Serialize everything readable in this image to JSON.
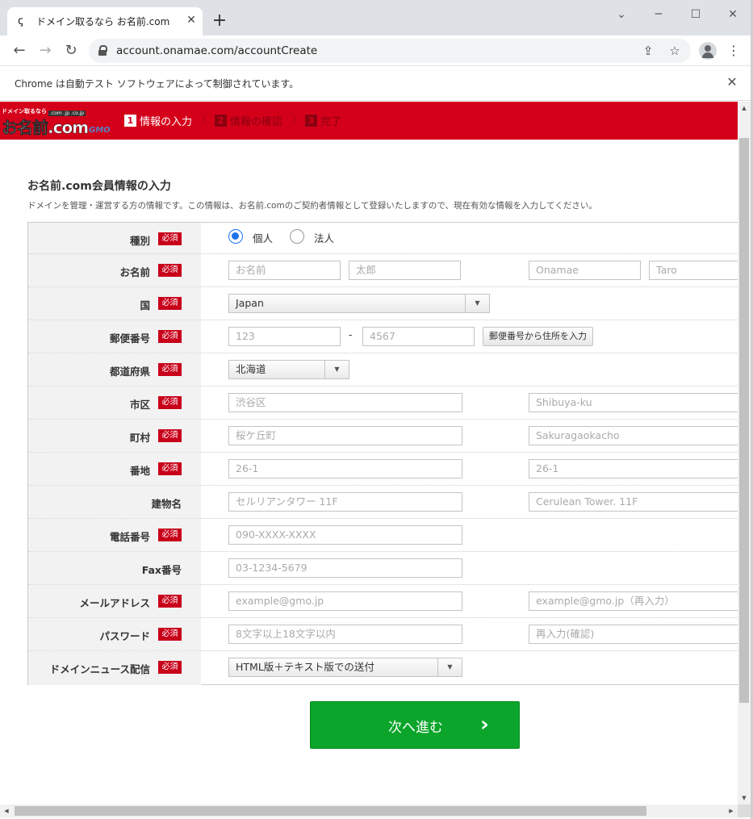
{
  "browser": {
    "tab_title": "ドメイン取るなら お名前.com",
    "tab_close": "✕",
    "new_tab": "+",
    "url": "account.onamae.com/accountCreate",
    "infobar_text": "Chrome は自動テスト ソフトウェアによって制御されています。",
    "infobar_close": "✕"
  },
  "header": {
    "logo_top": "ドメイン取るなら",
    "logo_main": "お名前.com",
    "logo_tlds": ".com .jp .co.jp",
    "logo_gmo": "GMO",
    "steps": [
      {
        "num": "1",
        "label": "情報の入力"
      },
      {
        "num": "2",
        "label": "情報の確認"
      },
      {
        "num": "3",
        "label": "完了"
      }
    ]
  },
  "form": {
    "title": "お名前.com会員情報の入力",
    "description": "ドメインを管理・運営する方の情報です。この情報は、お名前.comのご契約者情報として登録いたしますので、現在有効な情報を入力してください。",
    "required_badge": "必須",
    "rows": {
      "type": {
        "label": "種別",
        "options": [
          "個人",
          "法人"
        ],
        "selected": "個人"
      },
      "name": {
        "label": "お名前",
        "placeholders": [
          "お名前",
          "太郎",
          "Onamae",
          "Taro"
        ]
      },
      "country": {
        "label": "国",
        "value": "Japan"
      },
      "postal": {
        "label": "郵便番号",
        "placeholders": [
          "123",
          "4567"
        ],
        "separator": "-",
        "button": "郵便番号から住所を入力"
      },
      "prefecture": {
        "label": "都道府県",
        "value": "北海道"
      },
      "city": {
        "label": "市区",
        "placeholders": [
          "渋谷区",
          "Shibuya-ku"
        ]
      },
      "town": {
        "label": "町村",
        "placeholders": [
          "桜ケ丘町",
          "Sakuragaokacho"
        ]
      },
      "street": {
        "label": "番地",
        "placeholders": [
          "26-1",
          "26-1"
        ]
      },
      "building": {
        "label": "建物名",
        "placeholders": [
          "セルリアンタワー 11F",
          "Cerulean Tower. 11F"
        ]
      },
      "phone": {
        "label": "電話番号",
        "placeholder": "090-XXXX-XXXX"
      },
      "fax": {
        "label": "Fax番号",
        "placeholder": "03-1234-5679"
      },
      "email": {
        "label": "メールアドレス",
        "placeholders": [
          "example@gmo.jp",
          "example@gmo.jp（再入力）"
        ]
      },
      "password": {
        "label": "パスワード",
        "placeholders": [
          "8文字以上18文字以内",
          "再入力(確認)"
        ]
      },
      "news": {
        "label": "ドメインニュース配信",
        "value": "HTML版＋テキスト版での送付"
      }
    },
    "next_button": "次へ進む"
  },
  "icons": {
    "favicon": "onamae-favicon",
    "back": "back-arrow-icon",
    "forward": "forward-arrow-icon",
    "reload": "reload-icon",
    "lock": "lock-icon",
    "share": "share-icon",
    "bookmark": "star-icon",
    "profile": "profile-icon",
    "menu": "kebab-menu-icon"
  },
  "colors": {
    "brand_red": "#d4001a",
    "required_red": "#c8001a",
    "next_green": "#0aa52a",
    "radio_blue": "#1a73e8"
  }
}
